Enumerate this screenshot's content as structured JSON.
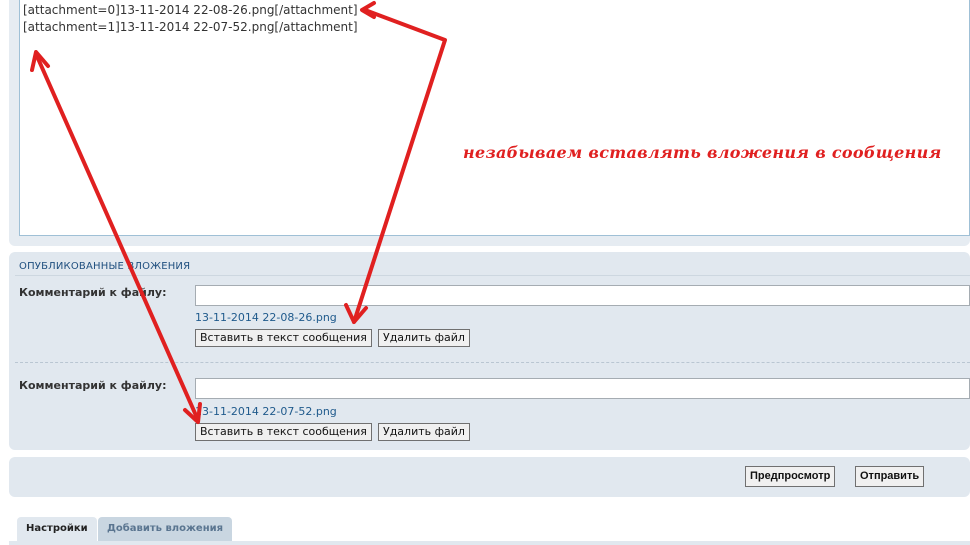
{
  "editor": {
    "lines": [
      "[attachment=0]13-11-2014 22-08-26.png[/attachment]",
      "[attachment=1]13-11-2014 22-07-52.png[/attachment]"
    ]
  },
  "annotation": {
    "text": "незабываем вставлять вложения в сообщения",
    "color": "#e02020"
  },
  "attachments_panel": {
    "heading": "ОПУБЛИКОВАННЫЕ ВЛОЖЕНИЯ",
    "items": [
      {
        "comment_label": "Комментарий к файлу:",
        "comment_value": "",
        "file_name": "13-11-2014 22-08-26.png",
        "insert_label": "Вставить в текст сообщения",
        "delete_label": "Удалить файл"
      },
      {
        "comment_label": "Комментарий к файлу:",
        "comment_value": "",
        "file_name": "13-11-2014 22-07-52.png",
        "insert_label": "Вставить в текст сообщения",
        "delete_label": "Удалить файл"
      }
    ]
  },
  "submit": {
    "preview_label": "Предпросмотр",
    "send_label": "Отправить"
  },
  "tabs": [
    {
      "label": "Настройки",
      "active": true
    },
    {
      "label": "Добавить вложения",
      "active": false
    }
  ],
  "colors": {
    "panel_bg": "#e1e8ef",
    "link": "#1f5a8c",
    "annotation_arrow": "#e02020"
  }
}
